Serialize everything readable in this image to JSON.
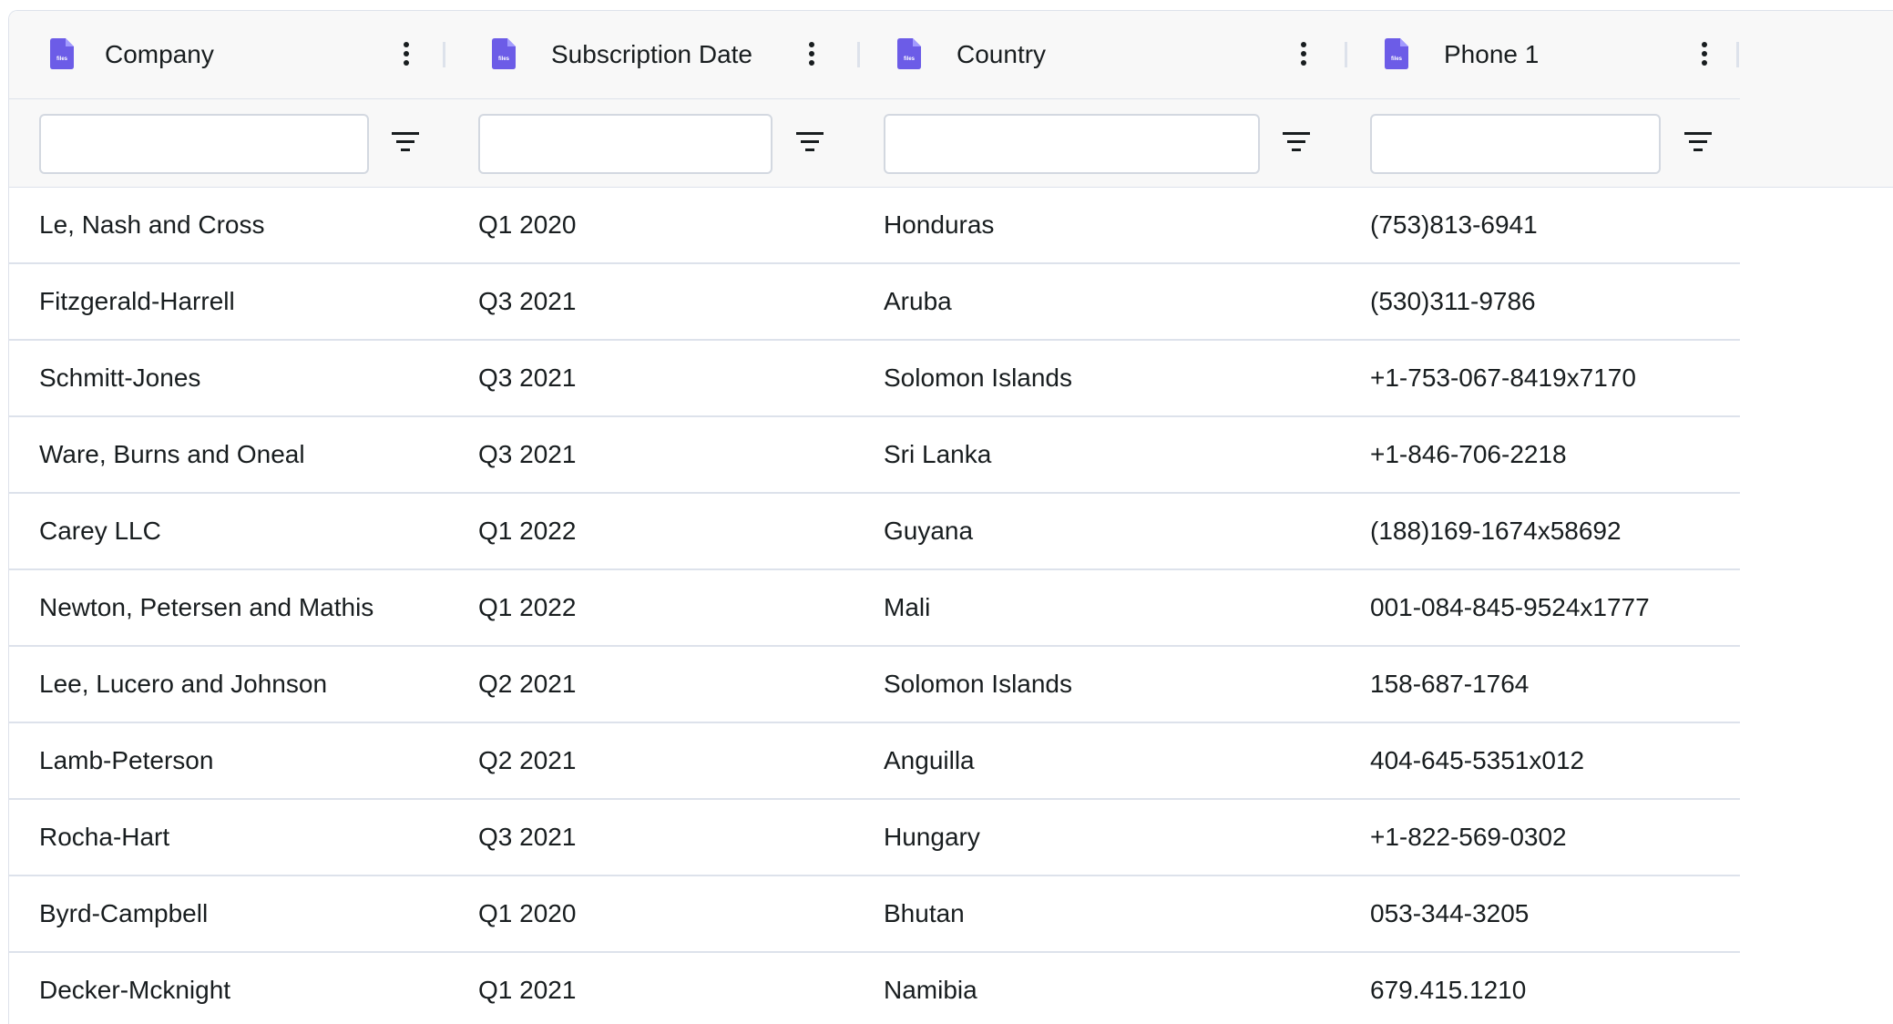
{
  "grid": {
    "accent_color": "#6c5ce7",
    "icon_text": "files",
    "columns": [
      {
        "title": "Company",
        "icon": "file-icon",
        "filter_value": "",
        "filter_placeholder": ""
      },
      {
        "title": "Subscription Date",
        "icon": "file-icon",
        "filter_value": "",
        "filter_placeholder": ""
      },
      {
        "title": "Country",
        "icon": "file-icon",
        "filter_value": "",
        "filter_placeholder": ""
      },
      {
        "title": "Phone 1",
        "icon": "file-icon",
        "filter_value": "",
        "filter_placeholder": ""
      }
    ],
    "rows": [
      [
        "Le, Nash and Cross",
        "Q1 2020",
        "Honduras",
        "(753)813-6941"
      ],
      [
        "Fitzgerald-Harrell",
        "Q3 2021",
        "Aruba",
        "(530)311-9786"
      ],
      [
        "Schmitt-Jones",
        "Q3 2021",
        "Solomon Islands",
        "+1-753-067-8419x7170"
      ],
      [
        "Ware, Burns and Oneal",
        "Q3 2021",
        "Sri Lanka",
        "+1-846-706-2218"
      ],
      [
        "Carey LLC",
        "Q1 2022",
        "Guyana",
        "(188)169-1674x58692"
      ],
      [
        "Newton, Petersen and Mathis",
        "Q1 2022",
        "Mali",
        "001-084-845-9524x1777"
      ],
      [
        "Lee, Lucero and Johnson",
        "Q2 2021",
        "Solomon Islands",
        "158-687-1764"
      ],
      [
        "Lamb-Peterson",
        "Q2 2021",
        "Anguilla",
        "404-645-5351x012"
      ],
      [
        "Rocha-Hart",
        "Q3 2021",
        "Hungary",
        "+1-822-569-0302"
      ],
      [
        "Byrd-Campbell",
        "Q1 2020",
        "Bhutan",
        "053-344-3205"
      ],
      [
        "Decker-Mcknight",
        "Q1 2021",
        "Namibia",
        "679.415.1210"
      ]
    ]
  }
}
